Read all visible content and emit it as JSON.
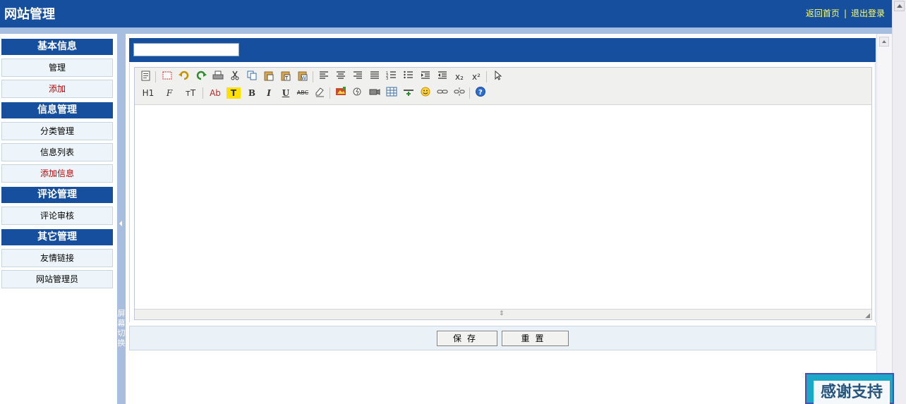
{
  "header": {
    "title": "网站管理",
    "links": {
      "home": "返回首页",
      "separator": "|",
      "logout": "退出登录"
    }
  },
  "sidebar": {
    "groups": [
      {
        "title": "基本信息",
        "items": [
          {
            "label": "管理",
            "highlight": false
          },
          {
            "label": "添加",
            "highlight": true
          }
        ]
      },
      {
        "title": "信息管理",
        "items": [
          {
            "label": "分类管理",
            "highlight": false
          },
          {
            "label": "信息列表",
            "highlight": false
          },
          {
            "label": "添加信息",
            "highlight": true
          }
        ]
      },
      {
        "title": "评论管理",
        "items": [
          {
            "label": "评论审核",
            "highlight": false
          }
        ]
      },
      {
        "title": "其它管理",
        "items": [
          {
            "label": "友情链接",
            "highlight": false
          },
          {
            "label": "网站管理员",
            "highlight": false
          }
        ]
      }
    ]
  },
  "splitter": {
    "label": "屏幕切换"
  },
  "main": {
    "title_input": {
      "value": "",
      "placeholder": ""
    },
    "editor": {
      "toolbar_row1": [
        "source-icon",
        "fullscreen-icon",
        "undo-icon",
        "redo-icon",
        "print-icon",
        "cut-icon",
        "copy-icon",
        "paste-icon",
        "paste-text-icon",
        "paste-word-icon",
        "align-left-icon",
        "align-center-icon",
        "align-right-icon",
        "justify-icon",
        "ordered-list-icon",
        "unordered-list-icon",
        "indent-icon",
        "outdent-icon",
        "subscript-icon",
        "superscript-icon",
        "select-all-icon"
      ],
      "toolbar_row2": [
        "heading-icon",
        "font-family-icon",
        "font-size-icon",
        "font-color-icon",
        "highlight-icon",
        "bold-icon",
        "italic-icon",
        "underline-icon",
        "strikethrough-icon",
        "remove-format-icon",
        "image-icon",
        "flash-icon",
        "media-icon",
        "table-icon",
        "horizontal-rule-icon",
        "emoticon-icon",
        "link-icon",
        "unlink-icon",
        "help-icon"
      ],
      "labels": {
        "heading": "H1",
        "font_family": "F",
        "font_size": "тT",
        "font_color": "Ab",
        "highlight": "T",
        "bold": "B",
        "italic": "I",
        "underline": "U",
        "strike": "ABC",
        "subscript": "x₂",
        "superscript": "x²"
      }
    },
    "buttons": {
      "save": "保存",
      "reset": "重置"
    }
  },
  "badge": {
    "text": "感谢支持"
  },
  "colors": {
    "brand": "#154f9d",
    "accent_link": "#ffff66",
    "alert_text": "#c00000"
  }
}
